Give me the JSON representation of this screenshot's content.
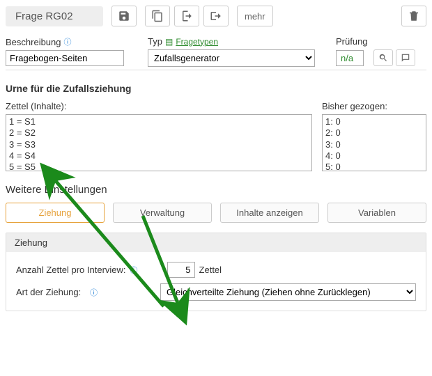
{
  "header": {
    "title": "Frage RG02",
    "more_label": "mehr"
  },
  "fields": {
    "beschreibung_label": "Beschreibung",
    "beschreibung_value": "Fragebogen-Seiten",
    "typ_label": "Typ",
    "fragetypen_link": "Fragetypen",
    "typ_value": "Zufallsgenerator",
    "pruefung_label": "Prüfung",
    "pruefung_value": "n/a"
  },
  "urne": {
    "title": "Urne für die Zufallsziehung",
    "zettel_label": "Zettel (Inhalte):",
    "gezogen_label": "Bisher gezogen:",
    "zettel_items": [
      "1 = S1",
      "2 = S2",
      "3 = S3",
      "4 = S4",
      "5 = S5"
    ],
    "gezogen_items": [
      "1: 0",
      "2: 0",
      "3: 0",
      "4: 0",
      "5: 0"
    ]
  },
  "settings": {
    "title": "Weitere Einstellungen",
    "tabs": {
      "ziehung": "Ziehung",
      "verwaltung": "Verwaltung",
      "inhalte": "Inhalte anzeigen",
      "variablen": "Variablen"
    }
  },
  "panel": {
    "title": "Ziehung",
    "anzahl_label": "Anzahl Zettel pro Interview:",
    "anzahl_value": "5",
    "anzahl_suffix": "Zettel",
    "art_label": "Art der Ziehung:",
    "art_value": "Gleichverteilte Ziehung (Ziehen ohne Zurücklegen)"
  }
}
